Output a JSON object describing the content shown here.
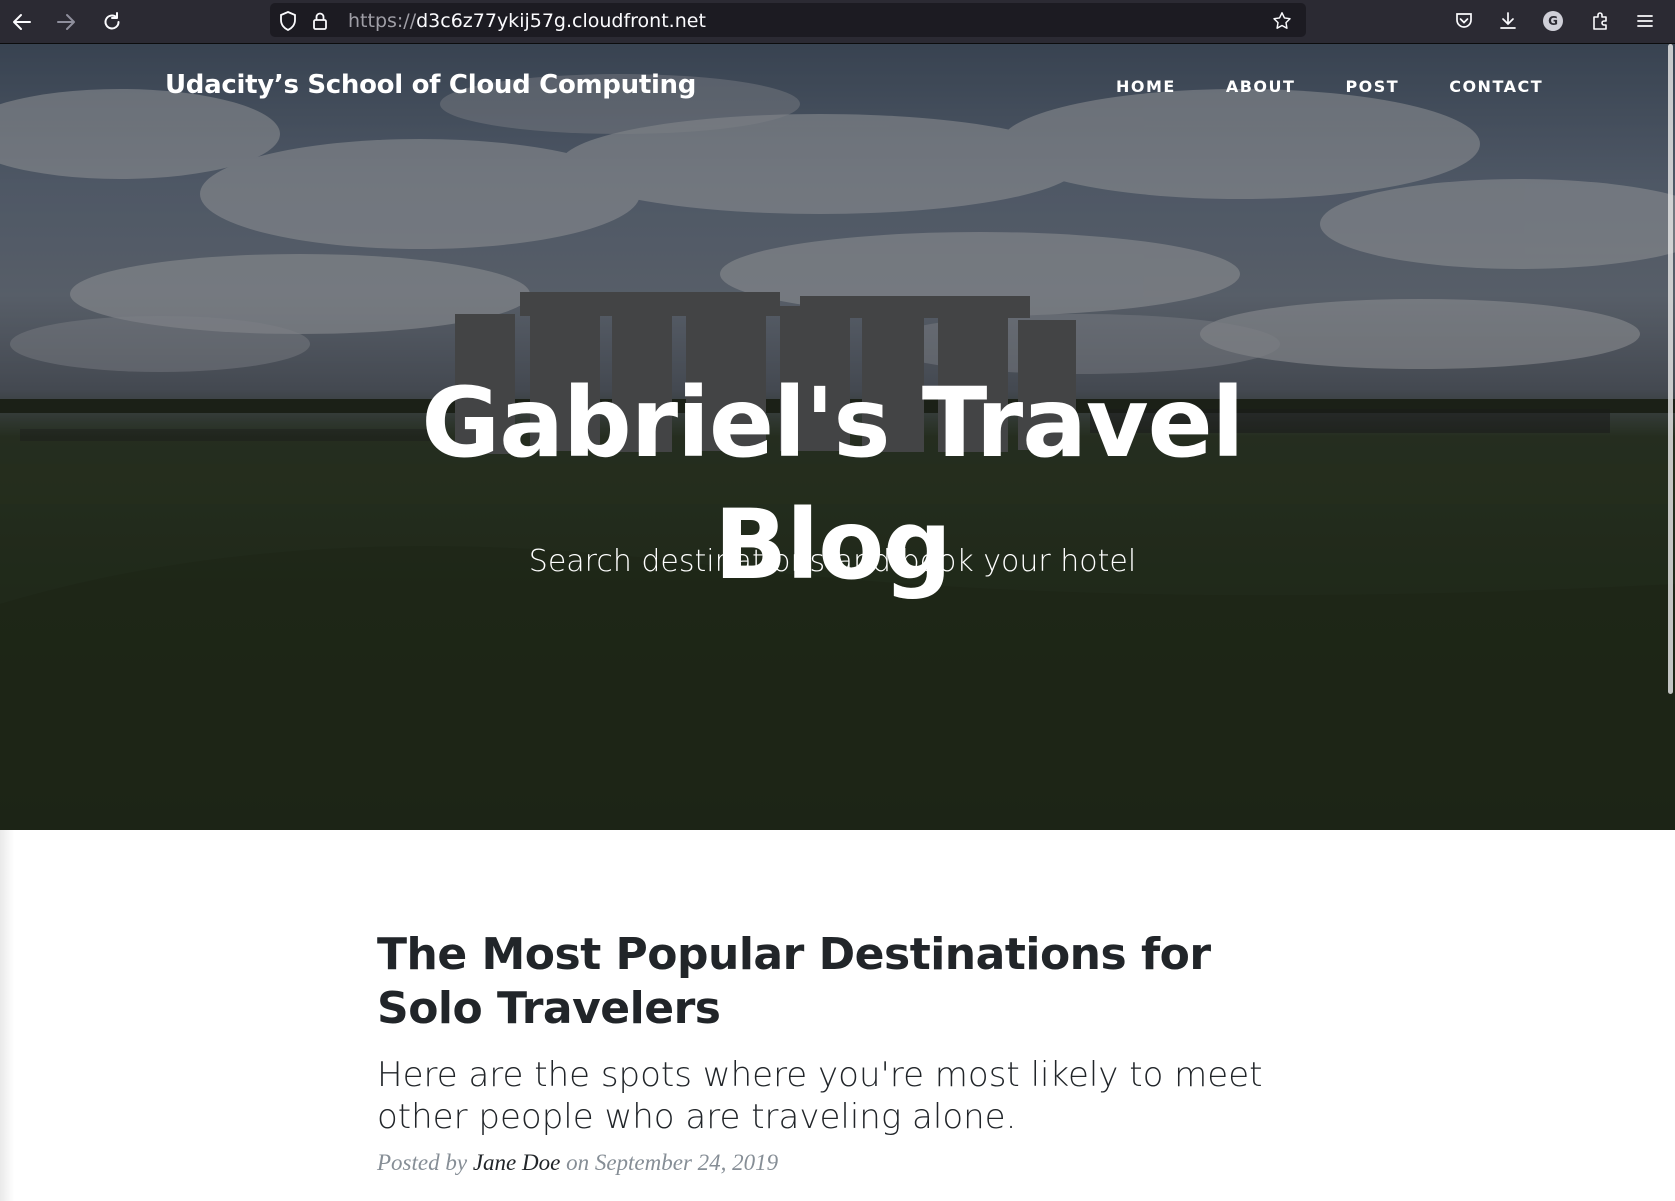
{
  "browser": {
    "url_scheme": "https://",
    "url_host": "d3c6z77ykij57g.cloudfront.net",
    "profile_initial": "G",
    "icons": {
      "back": "back-arrow-icon",
      "forward": "forward-arrow-icon",
      "reload": "reload-icon",
      "tracking": "shield-icon",
      "lock": "lock-icon",
      "bookmark": "star-icon",
      "pocket": "pocket-icon",
      "downloads": "download-icon",
      "extensions": "puzzle-icon",
      "menu": "hamburger-menu-icon"
    }
  },
  "site": {
    "brand": "Udacity’s School of Cloud Computing",
    "nav": [
      {
        "label": "HOME"
      },
      {
        "label": "ABOUT"
      },
      {
        "label": "POST"
      },
      {
        "label": "CONTACT"
      }
    ]
  },
  "hero": {
    "title": "Gabriel's Travel Blog",
    "subtitle": "Search destinations and book your hotel"
  },
  "post": {
    "title": "The Most Popular Destinations for Solo Travelers",
    "subtitle": "Here are the spots where you're most likely to meet other people who are traveling alone.",
    "meta_prefix": "Posted by",
    "author": "Jane Doe",
    "meta_on": "on",
    "date": "September 24, 2019"
  },
  "colors": {
    "chrome_bg": "#2b2a33",
    "urlbar_bg": "#1c1b22",
    "heading_text": "#212529",
    "meta_text": "#868e96"
  }
}
